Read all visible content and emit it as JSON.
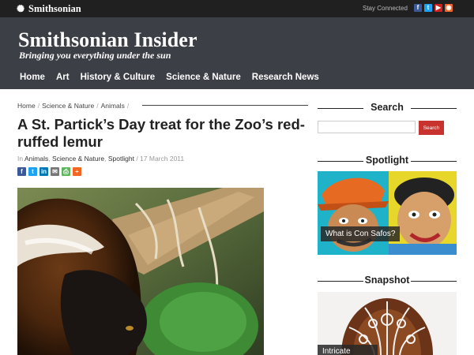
{
  "topbar": {
    "brand": "Smithsonian",
    "stay_connected": "Stay Connected",
    "social_icons": [
      {
        "name": "facebook-icon",
        "glyph": "f",
        "color": "#3b5998"
      },
      {
        "name": "twitter-icon",
        "glyph": "t",
        "color": "#1da1f2"
      },
      {
        "name": "youtube-icon",
        "glyph": "▶",
        "color": "#cd201f"
      },
      {
        "name": "rss-icon",
        "glyph": "◉",
        "color": "#f26522"
      }
    ]
  },
  "header": {
    "title": "Smithsonian Insider",
    "tagline": "Bringing you everything under the sun",
    "nav": [
      "Home",
      "Art",
      "History & Culture",
      "Science & Nature",
      "Research News"
    ]
  },
  "breadcrumb": [
    "Home",
    "Science & Nature",
    "Animals"
  ],
  "article": {
    "title": "A St. Partick’s Day treat for the Zoo’s red-ruffed lemur",
    "meta_prefix": "In",
    "categories": [
      "Animals",
      "Science & Nature",
      "Spotlight"
    ],
    "date": "17 March 2011",
    "share_icons": [
      {
        "name": "facebook-share-icon",
        "glyph": "f",
        "color": "#3b5998"
      },
      {
        "name": "twitter-share-icon",
        "glyph": "t",
        "color": "#1da1f2"
      },
      {
        "name": "linkedin-share-icon",
        "glyph": "in",
        "color": "#0077b5"
      },
      {
        "name": "email-share-icon",
        "glyph": "✉",
        "color": "#777777"
      },
      {
        "name": "print-share-icon",
        "glyph": "⎙",
        "color": "#5cb85c"
      },
      {
        "name": "more-share-icon",
        "glyph": "+",
        "color": "#f26522"
      }
    ]
  },
  "sidebar": {
    "search_title": "Search",
    "search_placeholder": "",
    "search_button": "Search",
    "spotlight_title": "Spotlight",
    "spotlight_caption": "What is Con Safos?",
    "snapshot_title": "Snapshot",
    "snapshot_caption": "Intricate beauty"
  },
  "colors": {
    "topbar": "#202020",
    "header": "#3d3f47",
    "search_button": "#c9332f"
  }
}
